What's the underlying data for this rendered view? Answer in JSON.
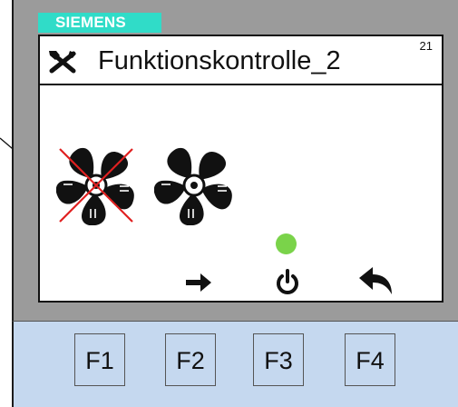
{
  "brand": {
    "label": "SIEMENS",
    "color": "#30dcc8"
  },
  "screen": {
    "title": "Funktionskontrolle_2",
    "screen_number": "21",
    "title_icon": "tools-icon"
  },
  "fans": [
    {
      "name": "fan-1",
      "icon": "fan-icon",
      "state": "disabled (red X)"
    },
    {
      "name": "fan-2",
      "icon": "fan-icon",
      "state": "normal"
    }
  ],
  "status_led": {
    "color": "#7ad34a"
  },
  "softkey_icons": [
    "arrow-right-icon",
    "power-icon",
    "return-icon"
  ],
  "function_keys": [
    {
      "label": "F1"
    },
    {
      "label": "F2"
    },
    {
      "label": "F3"
    },
    {
      "label": "F4"
    }
  ]
}
